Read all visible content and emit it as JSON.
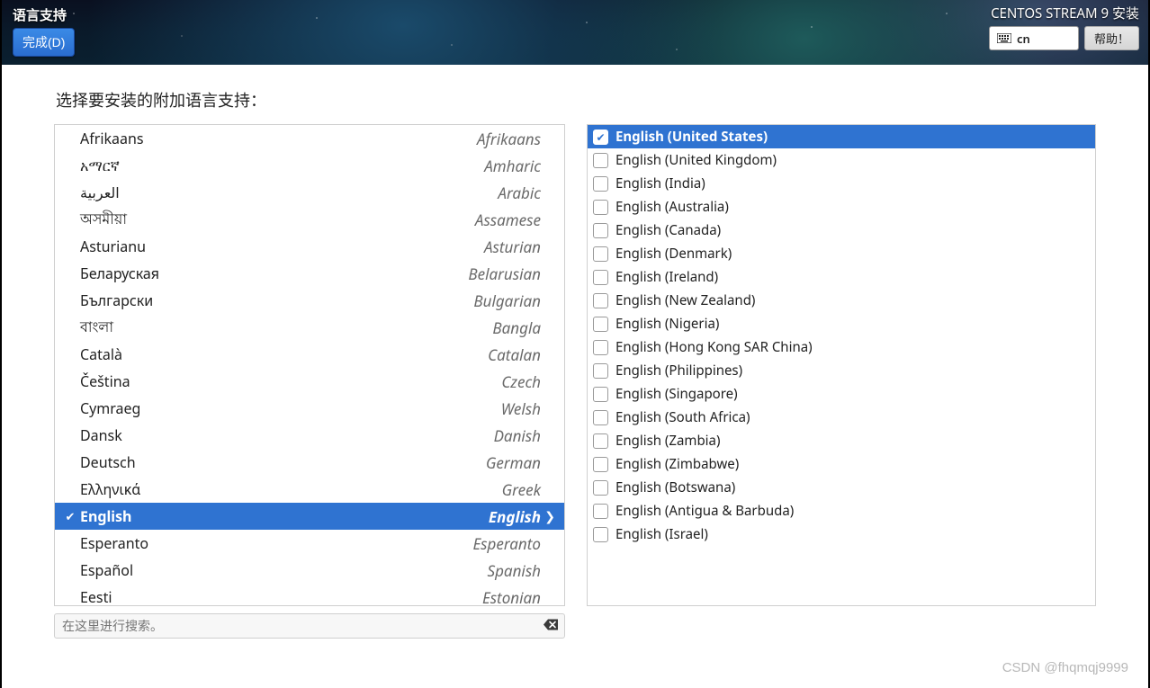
{
  "header": {
    "title": "语言支持",
    "done_label": "完成(D)",
    "install_title": "CENTOS STREAM 9 安装",
    "keyboard_layout": "cn",
    "help_label": "帮助！"
  },
  "prompt": "选择要安装的附加语言支持：",
  "search": {
    "placeholder": "在这里进行搜索。"
  },
  "languages": [
    {
      "native": "Afrikaans",
      "english": "Afrikaans",
      "selected": false
    },
    {
      "native": "አማርኛ",
      "english": "Amharic",
      "selected": false
    },
    {
      "native": "العربية",
      "english": "Arabic",
      "selected": false
    },
    {
      "native": "অসমীয়া",
      "english": "Assamese",
      "selected": false
    },
    {
      "native": "Asturianu",
      "english": "Asturian",
      "selected": false
    },
    {
      "native": "Беларуская",
      "english": "Belarusian",
      "selected": false
    },
    {
      "native": "Български",
      "english": "Bulgarian",
      "selected": false
    },
    {
      "native": "বাংলা",
      "english": "Bangla",
      "selected": false
    },
    {
      "native": "Català",
      "english": "Catalan",
      "selected": false
    },
    {
      "native": "Čeština",
      "english": "Czech",
      "selected": false
    },
    {
      "native": "Cymraeg",
      "english": "Welsh",
      "selected": false
    },
    {
      "native": "Dansk",
      "english": "Danish",
      "selected": false
    },
    {
      "native": "Deutsch",
      "english": "German",
      "selected": false
    },
    {
      "native": "Ελληνικά",
      "english": "Greek",
      "selected": false
    },
    {
      "native": "English",
      "english": "English",
      "selected": true
    },
    {
      "native": "Esperanto",
      "english": "Esperanto",
      "selected": false
    },
    {
      "native": "Español",
      "english": "Spanish",
      "selected": false
    },
    {
      "native": "Eesti",
      "english": "Estonian",
      "selected": false
    }
  ],
  "locales": [
    {
      "label": "English (United States)",
      "checked": true,
      "selected": true
    },
    {
      "label": "English (United Kingdom)",
      "checked": false,
      "selected": false
    },
    {
      "label": "English (India)",
      "checked": false,
      "selected": false
    },
    {
      "label": "English (Australia)",
      "checked": false,
      "selected": false
    },
    {
      "label": "English (Canada)",
      "checked": false,
      "selected": false
    },
    {
      "label": "English (Denmark)",
      "checked": false,
      "selected": false
    },
    {
      "label": "English (Ireland)",
      "checked": false,
      "selected": false
    },
    {
      "label": "English (New Zealand)",
      "checked": false,
      "selected": false
    },
    {
      "label": "English (Nigeria)",
      "checked": false,
      "selected": false
    },
    {
      "label": "English (Hong Kong SAR China)",
      "checked": false,
      "selected": false
    },
    {
      "label": "English (Philippines)",
      "checked": false,
      "selected": false
    },
    {
      "label": "English (Singapore)",
      "checked": false,
      "selected": false
    },
    {
      "label": "English (South Africa)",
      "checked": false,
      "selected": false
    },
    {
      "label": "English (Zambia)",
      "checked": false,
      "selected": false
    },
    {
      "label": "English (Zimbabwe)",
      "checked": false,
      "selected": false
    },
    {
      "label": "English (Botswana)",
      "checked": false,
      "selected": false
    },
    {
      "label": "English (Antigua & Barbuda)",
      "checked": false,
      "selected": false
    },
    {
      "label": "English (Israel)",
      "checked": false,
      "selected": false
    }
  ],
  "watermark": "CSDN @fhqmqj9999"
}
